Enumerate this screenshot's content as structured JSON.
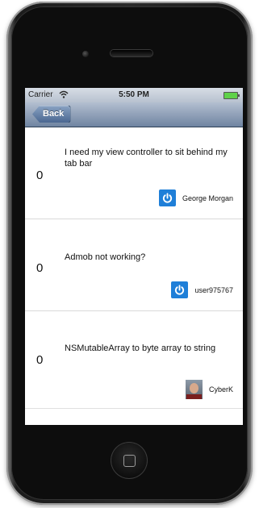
{
  "status_bar": {
    "carrier": "Carrier",
    "time": "5:50 PM",
    "wifi_icon": "wifi-icon",
    "battery_icon": "battery-icon"
  },
  "nav_bar": {
    "back_label": "Back"
  },
  "rows": [
    {
      "score": "0",
      "title": "I need my view controller to sit behind my tab bar",
      "user": "George Morgan",
      "avatar_type": "power-icon",
      "avatar_color": "#1f7fd8"
    },
    {
      "score": "0",
      "title": "Admob not working?",
      "user": "user975767",
      "avatar_type": "power-icon",
      "avatar_color": "#1f7fd8"
    },
    {
      "score": "0",
      "title": "NSMutableArray to byte array to string",
      "user": "CyberK",
      "avatar_type": "photo"
    }
  ]
}
